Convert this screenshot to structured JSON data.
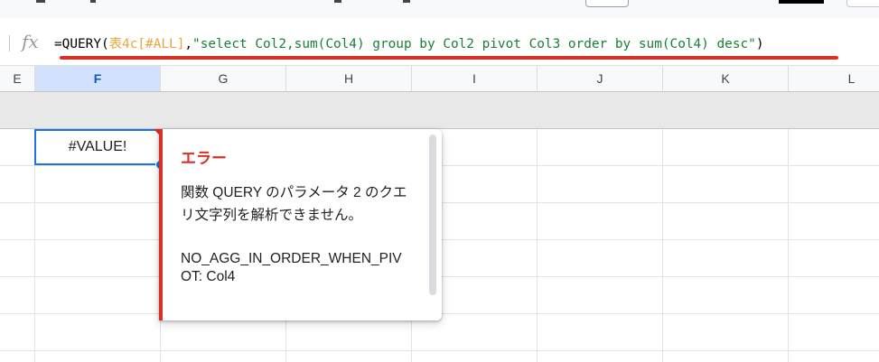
{
  "formula_bar": {
    "fx_label": "fx",
    "prefix": "=QUERY(",
    "ref": "表4c[#ALL]",
    "comma": ",",
    "query_string": "\"select Col2,sum(Col4) group by Col2 pivot Col3 order by sum(Col4) desc\"",
    "suffix": ")"
  },
  "columns": [
    {
      "label": "E"
    },
    {
      "label": "F",
      "selected": true
    },
    {
      "label": "G"
    },
    {
      "label": "H"
    },
    {
      "label": "I"
    },
    {
      "label": "J"
    },
    {
      "label": "K"
    },
    {
      "label": "L"
    }
  ],
  "active_cell": {
    "value": "#VALUE!"
  },
  "error_popup": {
    "title": "エラー",
    "message": "関数 QUERY のパラメータ 2 のクエリ文字列を解析できません。",
    "code": "NO_AGG_IN_ORDER_WHEN_PIVOT: Col4"
  },
  "colors": {
    "error_red": "#d93025",
    "selection_blue": "#1a73e8",
    "string_green": "#188038",
    "reference_orange": "#e8a53a"
  }
}
